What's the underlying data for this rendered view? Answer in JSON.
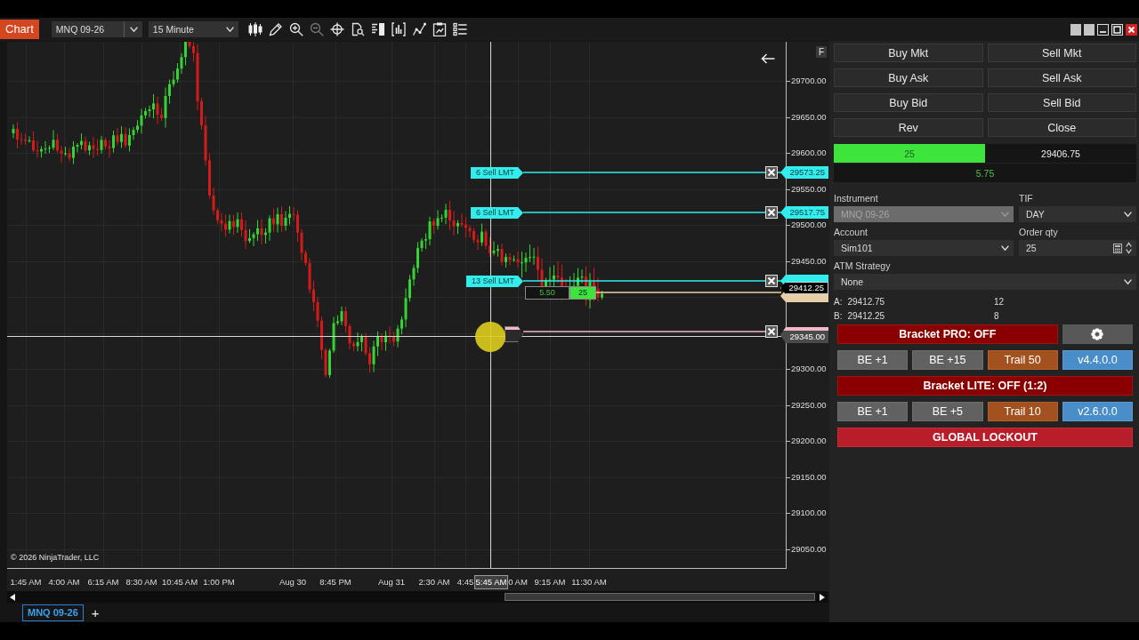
{
  "window": {
    "title": "Chart",
    "instrument": "MNQ 09-26",
    "interval": "15 Minute"
  },
  "chart": {
    "f_button": "F",
    "price_labels": [
      "29700.00",
      "29650.00",
      "29600.00",
      "29550.00",
      "29500.00",
      "29450.00",
      "29300.00",
      "29250.00",
      "29200.00",
      "29150.00",
      "29100.00",
      "29050.00"
    ],
    "orders": [
      {
        "label": "6 Sell LMT",
        "price": "29573.25"
      },
      {
        "label": "6 Sell LMT",
        "price": "29517.75"
      },
      {
        "label": "13 Sell LMT"
      }
    ],
    "position": {
      "pnl": "5.50",
      "quantity": "25"
    },
    "last_price": "29412.25",
    "stop_price": "29345.00",
    "copyright": "© 2026 NinjaTrader, LLC",
    "time_labels": [
      "1:45 AM",
      "4:00 AM",
      "6:15 AM",
      "8:30 AM",
      "10:45 AM",
      "1:00 PM",
      "Aug 30",
      "8:45 PM",
      "Aug 31",
      "2:30 AM",
      "4:45",
      "0 AM",
      "9:15 AM",
      "11:30 AM"
    ],
    "crosshair_time": "5:45 AM"
  },
  "chart_tabs": [
    {
      "label": "MNQ 09-26",
      "selected": true
    }
  ],
  "new_tab": "+",
  "order_panel": {
    "buttons": [
      "Buy Mkt",
      "Sell Mkt",
      "Buy Ask",
      "Sell Ask",
      "Buy Bid",
      "Sell Bid",
      "Rev",
      "Close"
    ],
    "position": {
      "quantity": "25",
      "price": "29406.75",
      "pnl": "5.75"
    },
    "fields": [
      {
        "label": "Instrument",
        "value": "MNQ 09-26",
        "kind": "combo",
        "disabled": true
      },
      {
        "label": "TIF",
        "value": "DAY",
        "kind": "combo",
        "disabled": false
      },
      {
        "label": "Account",
        "value": "Sim101",
        "kind": "combo",
        "disabled": false
      },
      {
        "label": "Order qty",
        "value": "25",
        "kind": "spinner",
        "disabled": false
      },
      {
        "label": "ATM Strategy",
        "value": "None",
        "kind": "combo",
        "disabled": false
      }
    ],
    "quotes": [
      {
        "label": "A:",
        "price": "29412.75",
        "size": "12"
      },
      {
        "label": "B:",
        "price": "29412.25",
        "size": "8"
      }
    ],
    "brackets": [
      {
        "label": "Bracket PRO: OFF",
        "on": false,
        "settings": true,
        "buttons": [
          {
            "label": "BE +1",
            "kind": "breakeven"
          },
          {
            "label": "BE +15",
            "kind": "breakeven"
          },
          {
            "label": "Trail 50",
            "kind": "trail"
          },
          {
            "label": "v4.4.0.0",
            "kind": "version"
          }
        ]
      },
      {
        "label": "Bracket LITE: OFF (1:2)",
        "on": false,
        "settings": false,
        "buttons": [
          {
            "label": "BE +1",
            "kind": "breakeven"
          },
          {
            "label": "BE +5",
            "kind": "breakeven"
          },
          {
            "label": "Trail 10",
            "kind": "trail"
          },
          {
            "label": "v2.6.0.0",
            "kind": "version"
          }
        ]
      }
    ],
    "lockout": "GLOBAL LOCKOUT"
  }
}
